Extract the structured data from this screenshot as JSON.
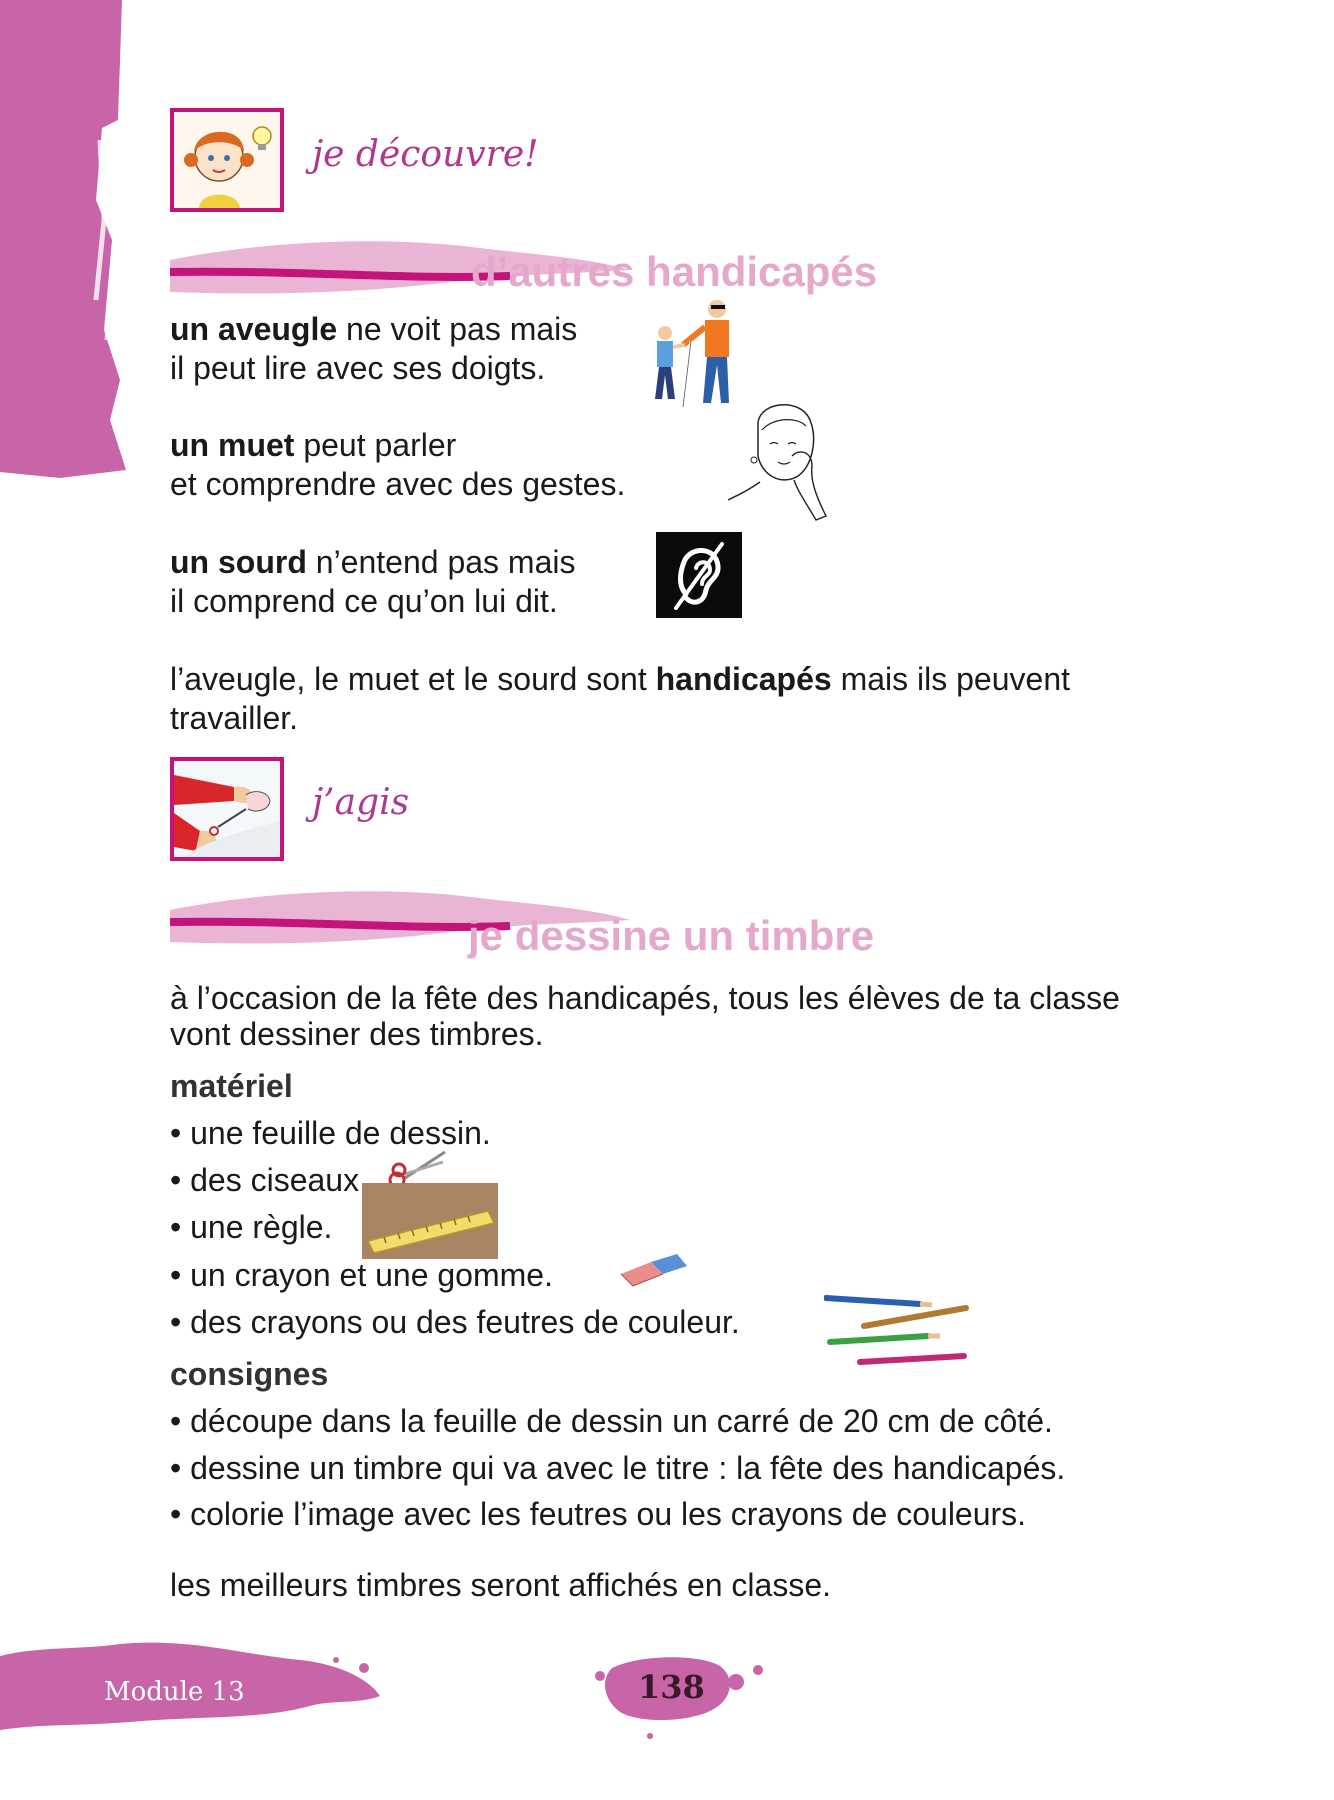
{
  "header1": {
    "title": "je découvre!"
  },
  "section1": {
    "title": "d’autres handicapés"
  },
  "blind": {
    "bold": "un aveugle",
    "rest": " ne voit pas mais",
    "line2": "il peut lire avec ses doigts."
  },
  "mute": {
    "bold": "un muet",
    "rest": " peut parler",
    "line2": "et comprendre avec des gestes."
  },
  "deaf": {
    "bold": "un sourd",
    "rest": " n’entend pas mais",
    "line2": "il comprend ce qu’on lui dit."
  },
  "summary": {
    "pre": "l’aveugle, le muet et le sourd sont ",
    "bold": "handicapés",
    "post": " mais ils peuvent",
    "line2": "travailler."
  },
  "header2": {
    "title": "j’agis"
  },
  "section2": {
    "title": "je dessine un timbre"
  },
  "intro": {
    "line1": "à l’occasion de la fête des handicapés, tous les élèves de ta classe",
    "line2": "vont dessiner des timbres."
  },
  "materiel": {
    "heading": "matériel",
    "items": [
      "• une feuille de dessin.",
      "• des ciseaux.",
      "• une règle.",
      "• un crayon et une gomme.",
      "• des crayons ou des feutres de couleur."
    ]
  },
  "consignes": {
    "heading": "consignes",
    "items": [
      "• découpe dans la feuille de dessin un carré de 20 cm de côté.",
      "• dessine un timbre qui va avec le titre : la fête des handicapés.",
      "• colorie l’image avec les feutres ou les crayons de couleurs."
    ]
  },
  "closing": "les meilleurs timbres seront affichés en classe.",
  "footer": {
    "module": "Module 13",
    "page": "138"
  },
  "colors": {
    "magenta": "#c4147a",
    "pink": "#e6a7cd",
    "band": "#c864a8"
  },
  "icons": [
    "girl-lightbulb-icon",
    "hands-cutting-icon",
    "blind-person-icon",
    "sign-language-icon",
    "deaf-ear-icon",
    "scissors-icon",
    "ruler-icon",
    "eraser-icon",
    "colored-pencils-icon"
  ]
}
